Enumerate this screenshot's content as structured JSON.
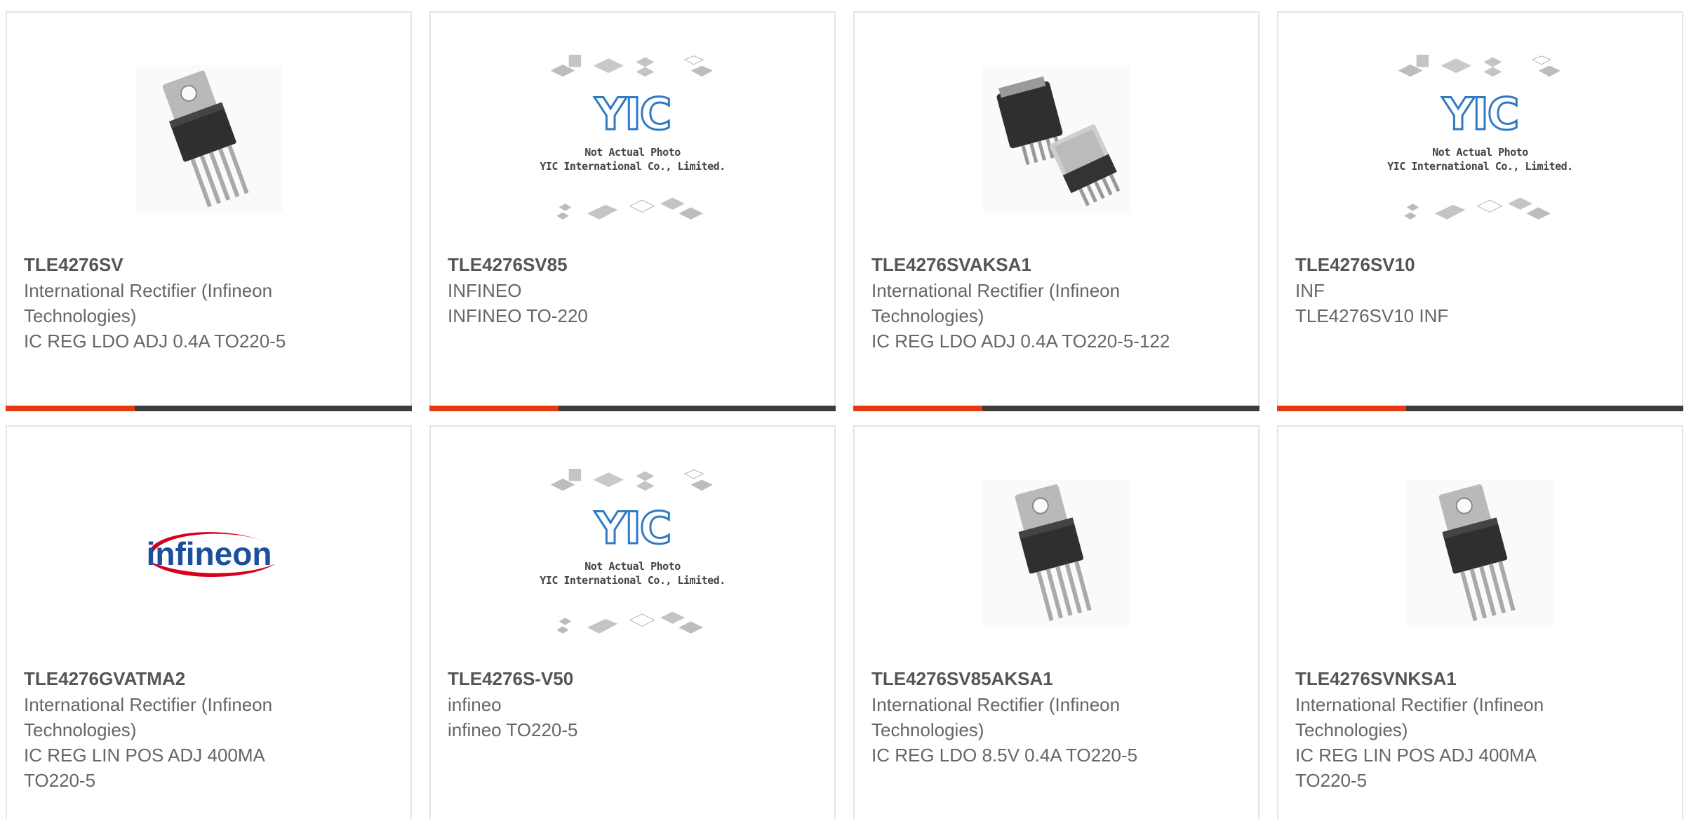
{
  "products": [
    {
      "part": "TLE4276SV",
      "mfr": "International Rectifier (Infineon Technologies)",
      "desc": "IC REG LDO ADJ 0.4A TO220-5",
      "image": "to220-5-transistor-photo"
    },
    {
      "part": "TLE4276SV85",
      "mfr": "INFINEO",
      "desc": "INFINEO TO-220",
      "image": "yic-placeholder"
    },
    {
      "part": "TLE4276SVAKSA1",
      "mfr": "International Rectifier (Infineon Technologies)",
      "desc": "IC REG LDO ADJ 0.4A TO220-5-122",
      "image": "to263-package-photo"
    },
    {
      "part": "TLE4276SV10",
      "mfr": "INF",
      "desc": "TLE4276SV10 INF",
      "image": "yic-placeholder"
    },
    {
      "part": "TLE4276GVATMA2",
      "mfr": "International Rectifier (Infineon Technologies)",
      "desc": "IC REG LIN POS ADJ 400MA TO220-5",
      "image": "infineon-logo"
    },
    {
      "part": "TLE4276S-V50",
      "mfr": "infineo",
      "desc": "infineo TO220-5",
      "image": "yic-placeholder"
    },
    {
      "part": "TLE4276SV85AKSA1",
      "mfr": "International Rectifier (Infineon Technologies)",
      "desc": "IC REG LDO 8.5V 0.4A TO220-5",
      "image": "to220-5-transistor-photo"
    },
    {
      "part": "TLE4276SVNKSA1",
      "mfr": "International Rectifier (Infineon Technologies)",
      "desc": "IC REG LIN POS ADJ 400MA TO220-5",
      "image": "to220-5-transistor-photo"
    }
  ],
  "placeholder": {
    "brand": "YIC",
    "line1": "Not Actual Photo",
    "line2": "YIC International Co., Limited."
  },
  "logo_text": "infineon",
  "colors": {
    "accent": "#e8380d",
    "bar": "#3c3c3c",
    "yic_blue": "#2e7bc4",
    "infineon_blue": "#1b4f9c",
    "infineon_red": "#d5001c"
  }
}
